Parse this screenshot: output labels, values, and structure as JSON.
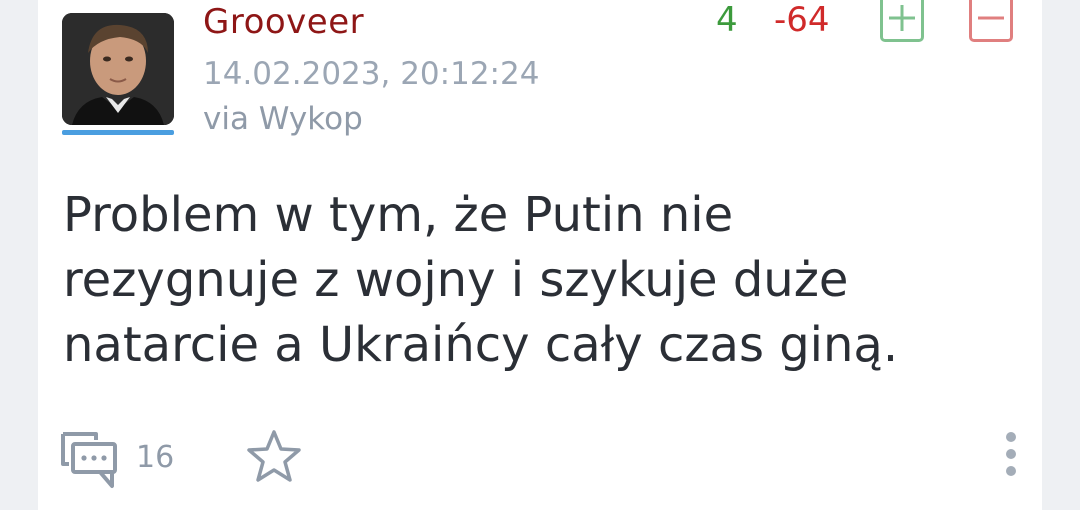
{
  "post": {
    "author": "Grooveer",
    "date": "14.02.2023, 20:12:24",
    "via": "via Wykop",
    "votes_plus": "4",
    "votes_minus": "-64",
    "text": "Problem w tym, że Putin nie rezygnuje z wojny i szykuje duże natarcie a Ukraińcy cały czas giną.",
    "comments_count": "16"
  },
  "icons": {
    "avatar": "user-avatar-photo",
    "vote_up": "plus-square-icon",
    "vote_down": "minus-square-icon",
    "comments": "comments-icon",
    "favorite": "star-icon",
    "more": "more-vertical-icon"
  },
  "colors": {
    "author": "#8e1616",
    "plus": "#3c9a3c",
    "minus": "#d02a2a",
    "plus_border": "#7fc28f",
    "minus_border": "#e07f7f",
    "avatar_underline": "#4a9ee0",
    "meta": "#9ba6b4"
  }
}
